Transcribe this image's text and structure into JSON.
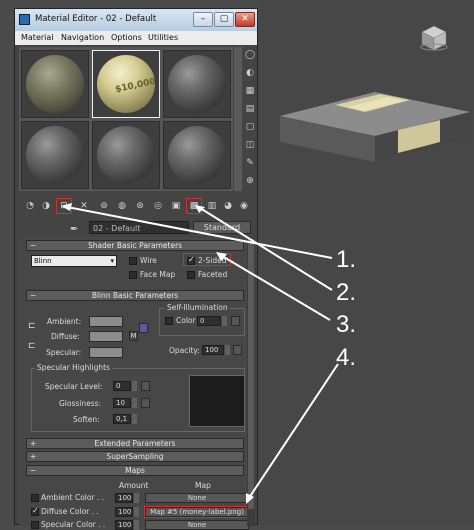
{
  "window": {
    "title": "Material Editor - 02 - Default",
    "min_glyph": "–",
    "max_glyph": "▢",
    "close_glyph": "✕"
  },
  "menu": [
    "Material",
    "Navigation",
    "Options",
    "Utilities"
  ],
  "slots": {
    "sphere_text": "$10,000"
  },
  "material": {
    "name": "02 - Default",
    "type_button": "Standard"
  },
  "shader_basic": {
    "title": "Shader Basic Parameters",
    "shader": "Blinn",
    "wire": "Wire",
    "two_sided": "2-Sided",
    "face_map": "Face Map",
    "faceted": "Faceted"
  },
  "blinn_basic": {
    "title": "Blinn Basic Parameters",
    "self_illum_title": "Self-Illumination",
    "color_label": "Color",
    "color_value": "0",
    "ambient": "Ambient:",
    "diffuse": "Diffuse:",
    "specular": "Specular:",
    "diffuse_map_btn": "M",
    "opacity_label": "Opacity:",
    "opacity_value": "100"
  },
  "specular_highlights": {
    "title": "Specular Highlights",
    "level_label": "Specular Level:",
    "level_value": "0",
    "gloss_label": "Glossiness:",
    "gloss_value": "10",
    "soften_label": "Soften:",
    "soften_value": "0,1"
  },
  "rollouts": {
    "extended": "Extended Parameters",
    "supersampling": "SuperSampling",
    "maps": "Maps"
  },
  "maps": {
    "col_amount": "Amount",
    "col_map": "Map",
    "rows": [
      {
        "label": "Ambient Color . .",
        "amount": "100",
        "map": "None",
        "checked": false
      },
      {
        "label": "Diffuse Color . .",
        "amount": "100",
        "map": "Map #5 (money-label.png)",
        "checked": true
      },
      {
        "label": "Specular Color . .",
        "amount": "100",
        "map": "None",
        "checked": false
      }
    ]
  },
  "annotations": [
    "1.",
    "2.",
    "3.",
    "4."
  ],
  "colors": {
    "highlight": "#d32f2f",
    "arrow": "#ffffff",
    "viewport": "#474747"
  }
}
